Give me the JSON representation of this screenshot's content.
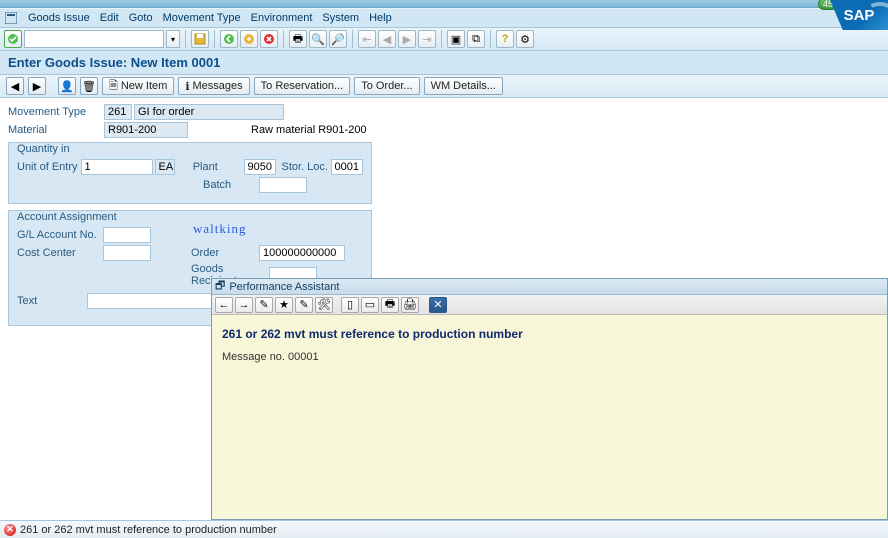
{
  "titlebar": {
    "green": "45"
  },
  "menu": {
    "items": [
      "Goods Issue",
      "Edit",
      "Goto",
      "Movement Type",
      "Environment",
      "System",
      "Help"
    ]
  },
  "app_title": "Enter Goods Issue: New Item 0001",
  "app_toolbar": {
    "new_item": "New Item",
    "messages": "Messages",
    "to_reservation": "To Reservation...",
    "to_order": "To Order...",
    "wm_details": "WM Details..."
  },
  "header": {
    "movement_type_label": "Movement Type",
    "movement_type_code": "261",
    "movement_type_text": "GI for order",
    "material_label": "Material",
    "material_code": "R901-200",
    "material_desc": "Raw material R901-200"
  },
  "quantity": {
    "group_title": "Quantity in",
    "unit_of_entry_label": "Unit of Entry",
    "qty": "1",
    "uom": "EA",
    "plant_label": "Plant",
    "plant": "9050",
    "sloc_label": "Stor. Loc.",
    "sloc": "0001",
    "batch_label": "Batch",
    "batch": ""
  },
  "account": {
    "group_title": "Account Assignment",
    "gl_label": "G/L Account No.",
    "gl": "",
    "cc_label": "Cost Center",
    "cc": "",
    "order_label": "Order",
    "order": "100000000000",
    "recipient_label": "Goods Recipient",
    "recipient": "",
    "text_label": "Text",
    "text": "",
    "watermark": "waltking"
  },
  "perf": {
    "title": "Performance Assistant",
    "heading": "261 or 262 mvt must reference to production number",
    "msg_no": "Message no. 00001"
  },
  "status": {
    "text": "261 or 262 mvt must reference to production number"
  },
  "sap_logo": "SAP"
}
